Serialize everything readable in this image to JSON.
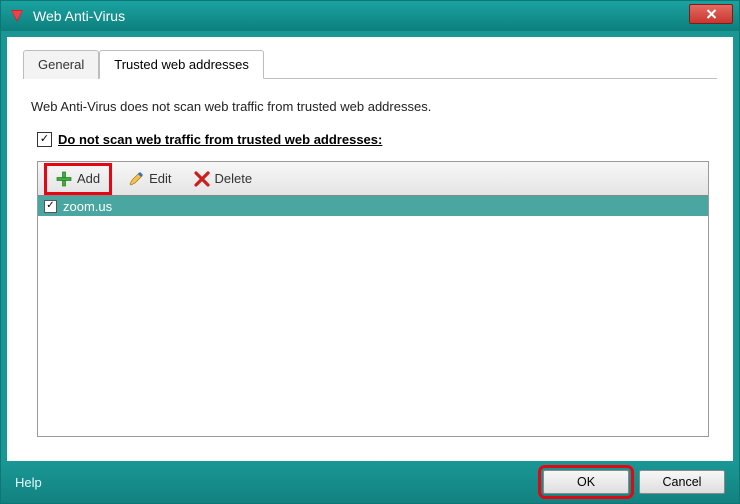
{
  "window": {
    "title": "Web Anti-Virus"
  },
  "tabs": {
    "general": "General",
    "trusted": "Trusted web addresses"
  },
  "body": {
    "description": "Web Anti-Virus does not scan web traffic from trusted web addresses.",
    "checkbox_label": "Do not scan web traffic from trusted web addresses:"
  },
  "toolbar": {
    "add": "Add",
    "edit": "Edit",
    "delete": "Delete"
  },
  "list": {
    "items": [
      {
        "checked": true,
        "value": "zoom.us"
      }
    ]
  },
  "footer": {
    "help": "Help",
    "ok": "OK",
    "cancel": "Cancel"
  }
}
